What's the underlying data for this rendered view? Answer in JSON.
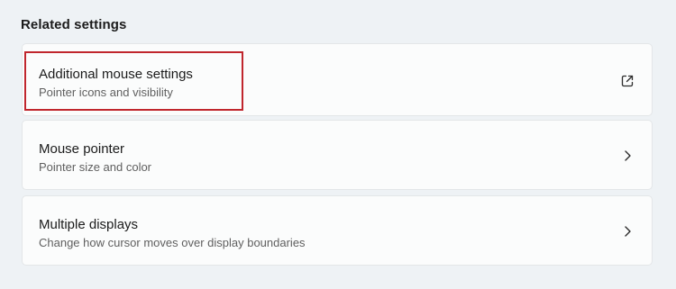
{
  "section": {
    "title": "Related settings"
  },
  "items": [
    {
      "title": "Additional mouse settings",
      "subtitle": "Pointer icons and visibility",
      "icon": "open-external-icon"
    },
    {
      "title": "Mouse pointer",
      "subtitle": "Pointer size and color",
      "icon": "chevron-right-icon"
    },
    {
      "title": "Multiple displays",
      "subtitle": "Change how cursor moves over display boundaries",
      "icon": "chevron-right-icon"
    }
  ],
  "colors": {
    "background": "#eef2f5",
    "card": "#fbfcfc",
    "highlight": "#c0262d"
  }
}
